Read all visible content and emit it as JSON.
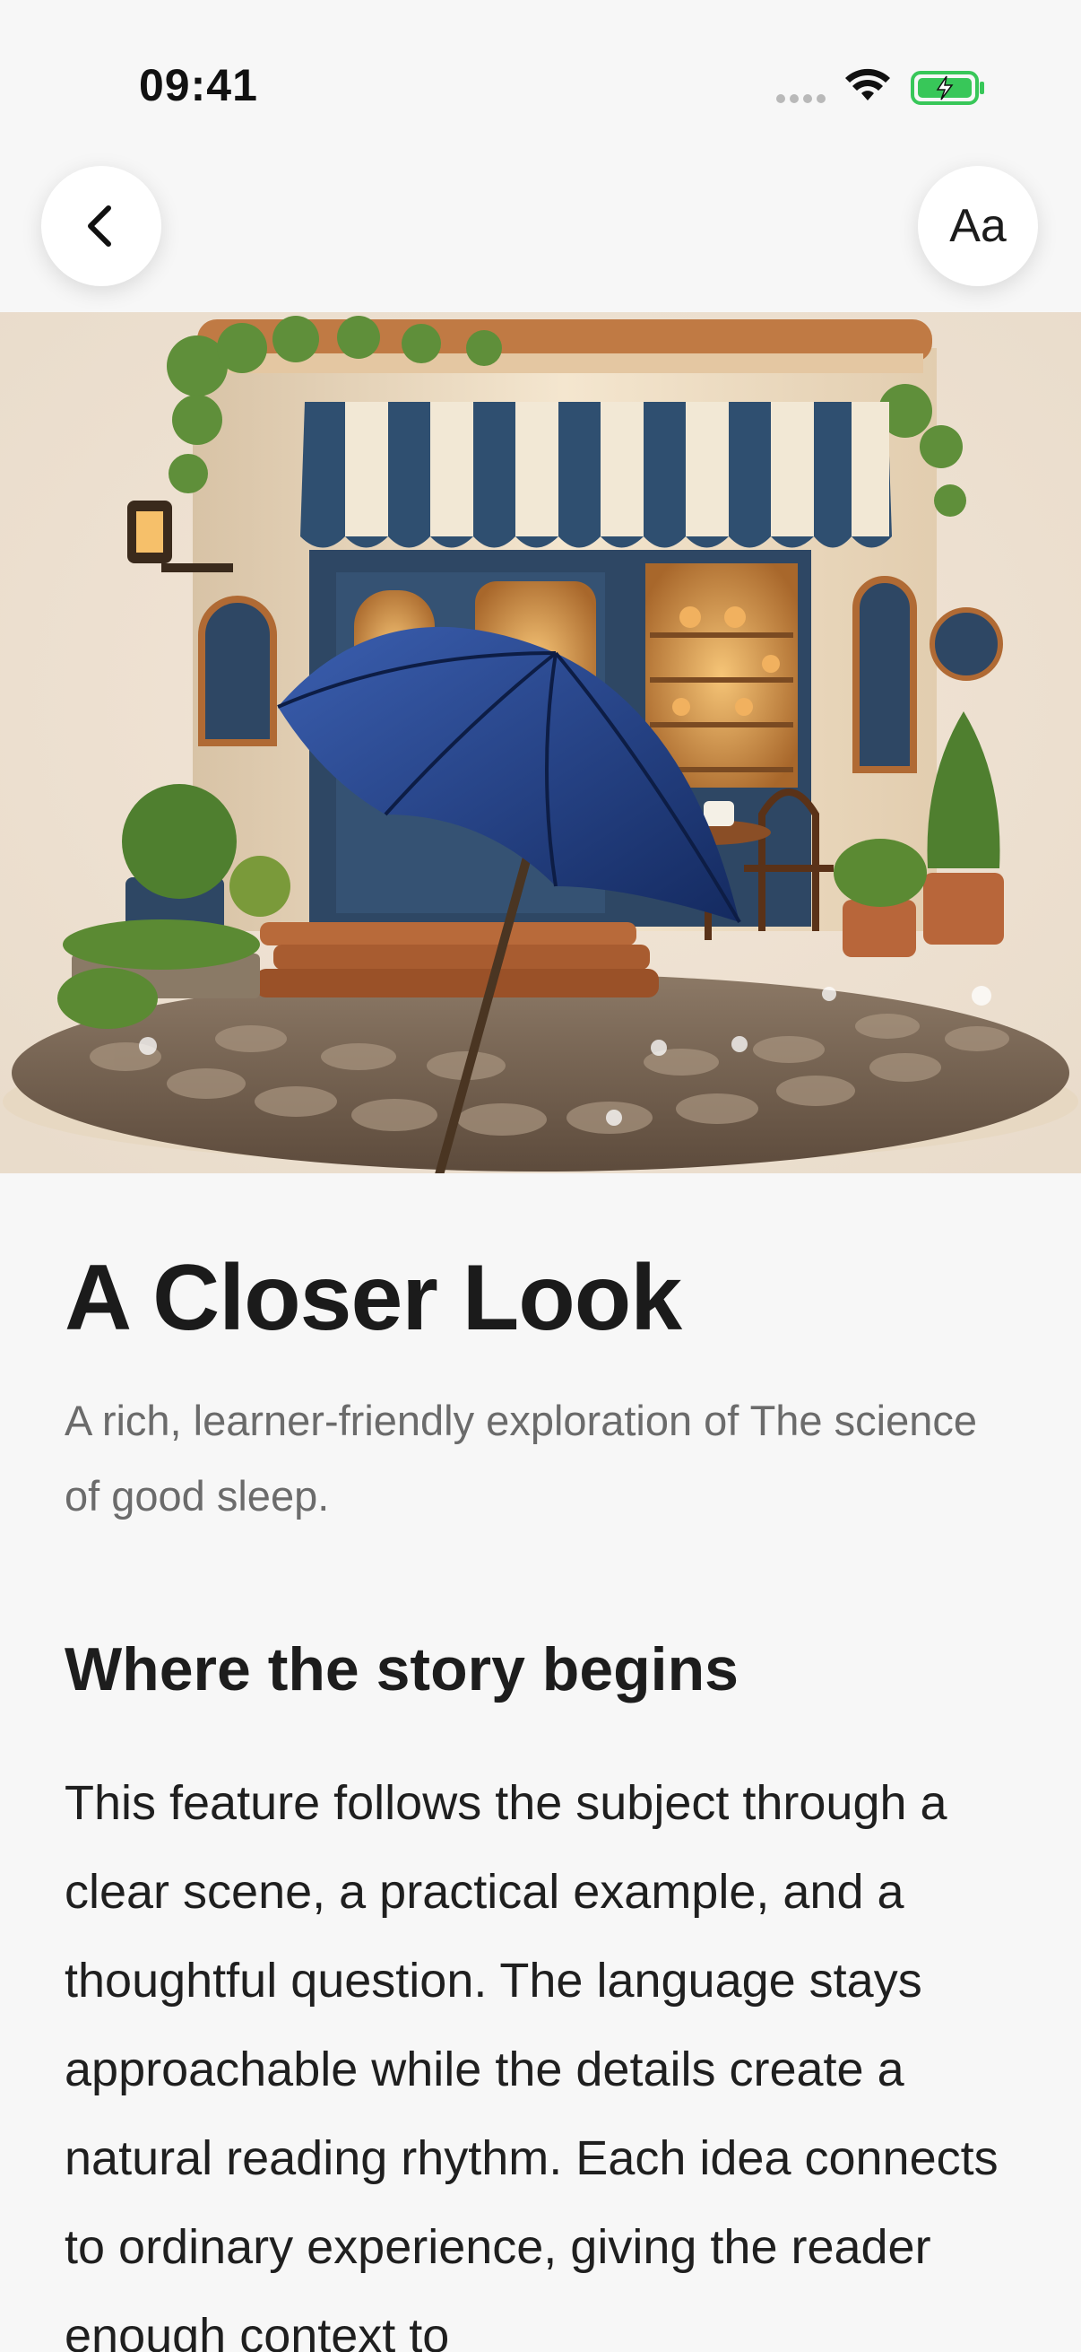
{
  "status_bar": {
    "time": "09:41"
  },
  "toolbar": {
    "back_icon": "chevron-left-icon",
    "text_size_label": "Aa"
  },
  "hero": {
    "image_subject": "miniature cafe with striped awning and blue umbrella on cobblestone platform"
  },
  "article": {
    "title": "A Closer Look",
    "subtitle": "A rich, learner-friendly exploration of The science of good sleep.",
    "section_heading": "Where the story begins",
    "body": "This feature follows the subject through a clear scene, a practical example, and a thoughtful question. The language stays approachable while the details create a natural reading rhythm. Each idea connects to ordinary experience, giving the reader enough context to"
  },
  "colors": {
    "background": "#f7f7f7",
    "awning_blue": "#2f4f70",
    "umbrella_blue": "#1e3a7a",
    "battery_green": "#38c759"
  }
}
